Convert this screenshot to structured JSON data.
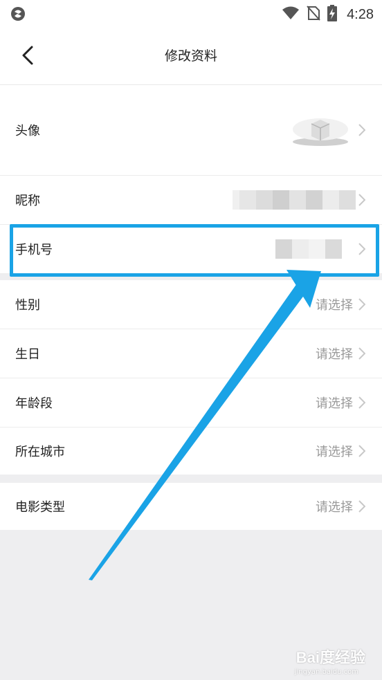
{
  "status_bar": {
    "time": "4:28",
    "icons": [
      "app-logo-icon",
      "wifi-icon",
      "no-sim-icon",
      "battery-charging-icon"
    ]
  },
  "nav": {
    "title": "修改资料",
    "back_icon": "chevron-left-icon"
  },
  "rows": {
    "avatar": {
      "label": "头像"
    },
    "nickname": {
      "label": "昵称"
    },
    "phone": {
      "label": "手机号"
    },
    "gender": {
      "label": "性别",
      "value": "请选择"
    },
    "birthday": {
      "label": "生日",
      "value": "请选择"
    },
    "age_group": {
      "label": "年龄段",
      "value": "请选择"
    },
    "city": {
      "label": "所在城市",
      "value": "请选择"
    },
    "movie_type": {
      "label": "电影类型",
      "value": "请选择"
    }
  },
  "annotation": {
    "highlight_color": "#1aa3e6",
    "target": "phone"
  },
  "watermark": {
    "text": "Bai度经验",
    "sub": "jingyan.baidu.com"
  }
}
